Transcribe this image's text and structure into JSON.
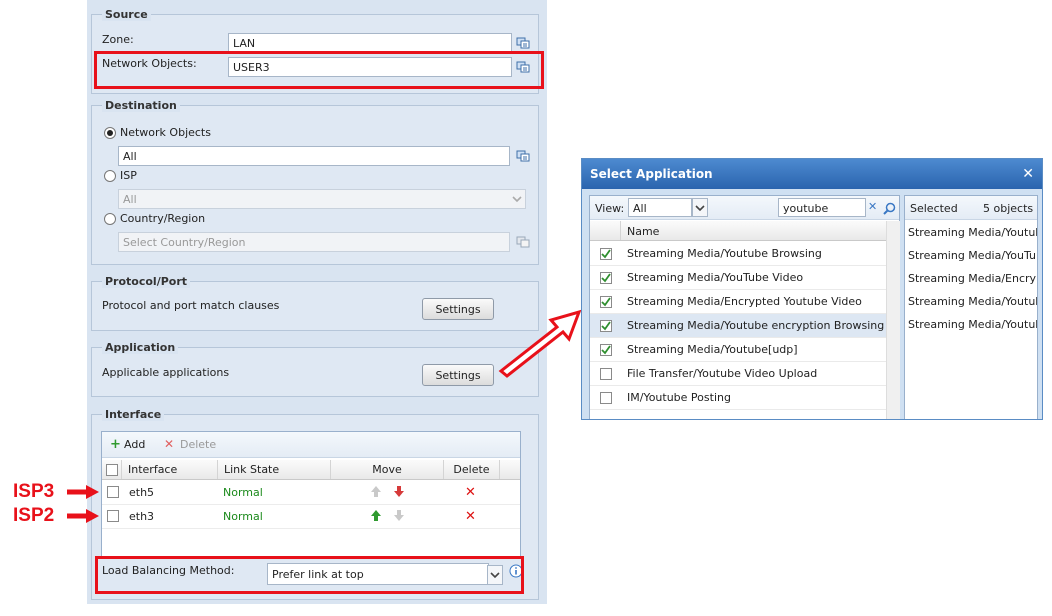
{
  "source": {
    "legend": "Source",
    "zone_label": "Zone:",
    "zone_value": "LAN",
    "network_objects_label": "Network Objects:",
    "network_objects_value": "USER3"
  },
  "destination": {
    "legend": "Destination",
    "opt_network_objects": "Network Objects",
    "network_objects_value": "All",
    "opt_isp": "ISP",
    "isp_value": "All",
    "opt_country": "Country/Region",
    "country_placeholder": "Select Country/Region"
  },
  "protocol": {
    "legend": "Protocol/Port",
    "desc": "Protocol and port match clauses",
    "button": "Settings"
  },
  "application": {
    "legend": "Application",
    "desc": "Applicable applications",
    "button": "Settings"
  },
  "interface": {
    "legend": "Interface",
    "add_label": "Add",
    "delete_label": "Delete",
    "columns": [
      "Interface",
      "Link State",
      "Move",
      "Delete"
    ],
    "rows": [
      {
        "name": "eth5",
        "state": "Normal"
      },
      {
        "name": "eth3",
        "state": "Normal"
      }
    ],
    "lb_label": "Load Balancing Method:",
    "lb_value": "Prefer link at top"
  },
  "annotations": {
    "isp3": "ISP3",
    "isp2": "ISP2"
  },
  "dialog": {
    "title": "Select Application",
    "close": "✕",
    "view_label": "View:",
    "view_value": "All",
    "search_value": "youtube",
    "name_col": "Name",
    "apps": [
      {
        "name": "Streaming Media/Youtube Browsing",
        "checked": true
      },
      {
        "name": "Streaming Media/YouTube Video",
        "checked": true
      },
      {
        "name": "Streaming Media/Encrypted Youtube Video",
        "checked": true
      },
      {
        "name": "Streaming Media/Youtube encryption Browsing",
        "checked": true
      },
      {
        "name": "Streaming Media/Youtube[udp]",
        "checked": true
      },
      {
        "name": "File Transfer/Youtube Video Upload",
        "checked": false
      },
      {
        "name": "IM/Youtube Posting",
        "checked": false
      }
    ],
    "selected_label": "Selected",
    "selected_count": "5 objects",
    "selected_items": [
      "Streaming Media/Youtube Browsing",
      "Streaming Media/YouTube Video",
      "Streaming Media/Encrypted Youtube Video",
      "Streaming Media/Youtube encryption Browsing",
      "Streaming Media/Youtube[udp]"
    ]
  },
  "colors": {
    "annotation_red": "#e8111a",
    "status_green": "#1c8a1c",
    "dialog_title": "#2a64ae"
  }
}
